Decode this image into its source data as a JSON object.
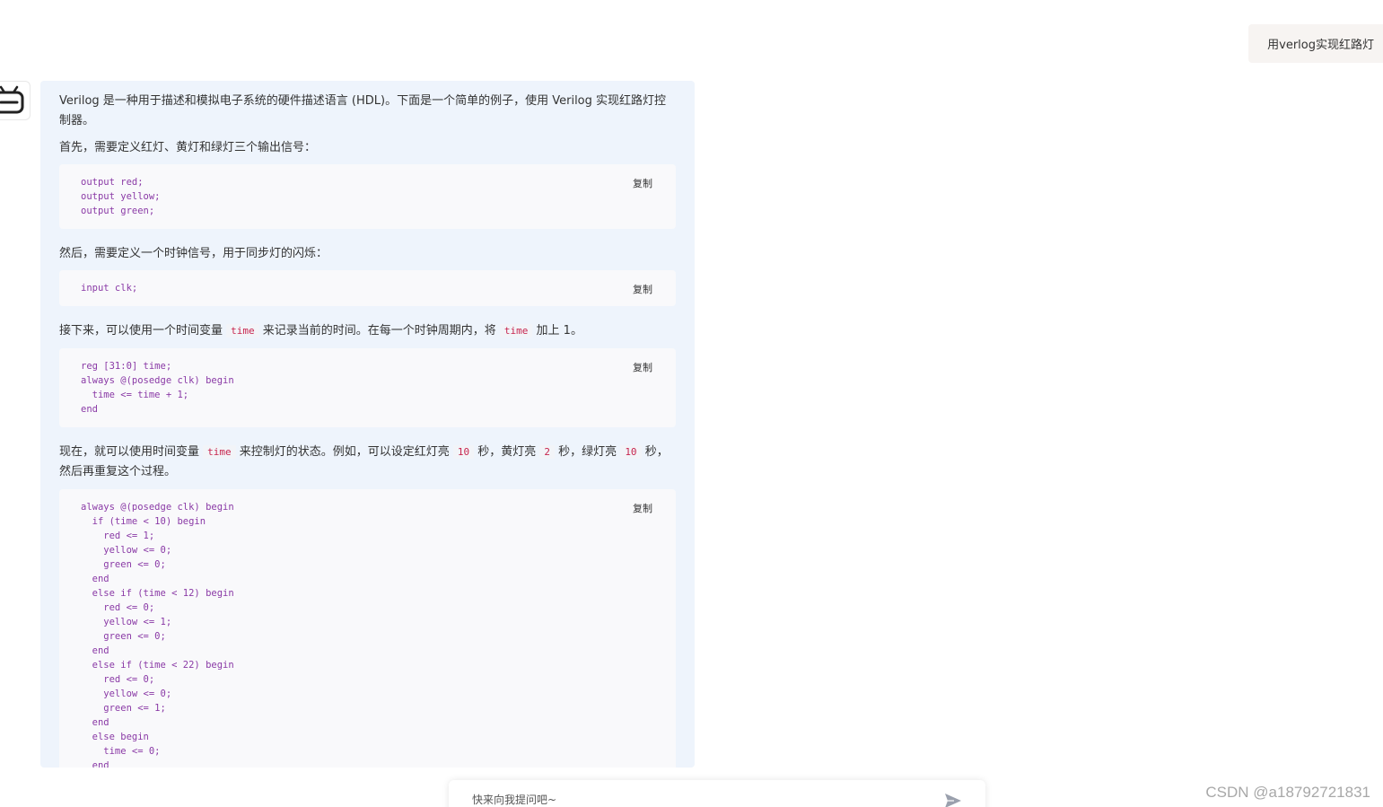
{
  "user_message": {
    "text": "用verlog实现红路灯"
  },
  "answer": {
    "intro": "Verilog 是一种用于描述和模拟电子系统的硬件描述语言 (HDL)。下面是一个简单的例子，使用 Verilog 实现红路灯控制器。",
    "step1": "首先，需要定义红灯、黄灯和绿灯三个输出信号：",
    "code1": "output red;\noutput yellow;\noutput green;",
    "step2": "然后，需要定义一个时钟信号，用于同步灯的闪烁：",
    "code2": "input clk;",
    "step3": {
      "part1": "接下来，可以使用一个时间变量 ",
      "code_a": "time",
      "part2": " 来记录当前的时间。在每一个时钟周期内，将 ",
      "code_b": "time",
      "part3": " 加上 1。"
    },
    "code3": "reg [31:0] time;\nalways @(posedge clk) begin\n  time <= time + 1;\nend",
    "step4": {
      "part1": "现在，就可以使用时间变量 ",
      "code_a": "time",
      "part2": " 来控制灯的状态。例如，可以设定红灯亮 ",
      "code_b": "10",
      "part3": " 秒，黄灯亮 ",
      "code_c": "2",
      "part4": " 秒，绿灯亮 ",
      "code_d": "10",
      "part5": " 秒，然后再重复这个过程。"
    },
    "code4": "always @(posedge clk) begin\n  if (time < 10) begin\n    red <= 1;\n    yellow <= 0;\n    green <= 0;\n  end\n  else if (time < 12) begin\n    red <= 0;\n    yellow <= 1;\n    green <= 0;\n  end\n  else if (time < 22) begin\n    red <= 0;\n    yellow <= 0;\n    green <= 1;\n  end\n  else begin\n    time <= 0;\n  end",
    "copy_label": "复制"
  },
  "input": {
    "placeholder": "快来向我提问吧~"
  },
  "icons": {
    "avatar": "robot-icon",
    "send": "send-icon"
  },
  "watermark": "CSDN @a18792721831",
  "colors": {
    "answer_bg": "#eef4fc",
    "code_bg": "#f9f9fb",
    "inline_code": "#c7254e",
    "code_text": "#8a3aa6"
  }
}
